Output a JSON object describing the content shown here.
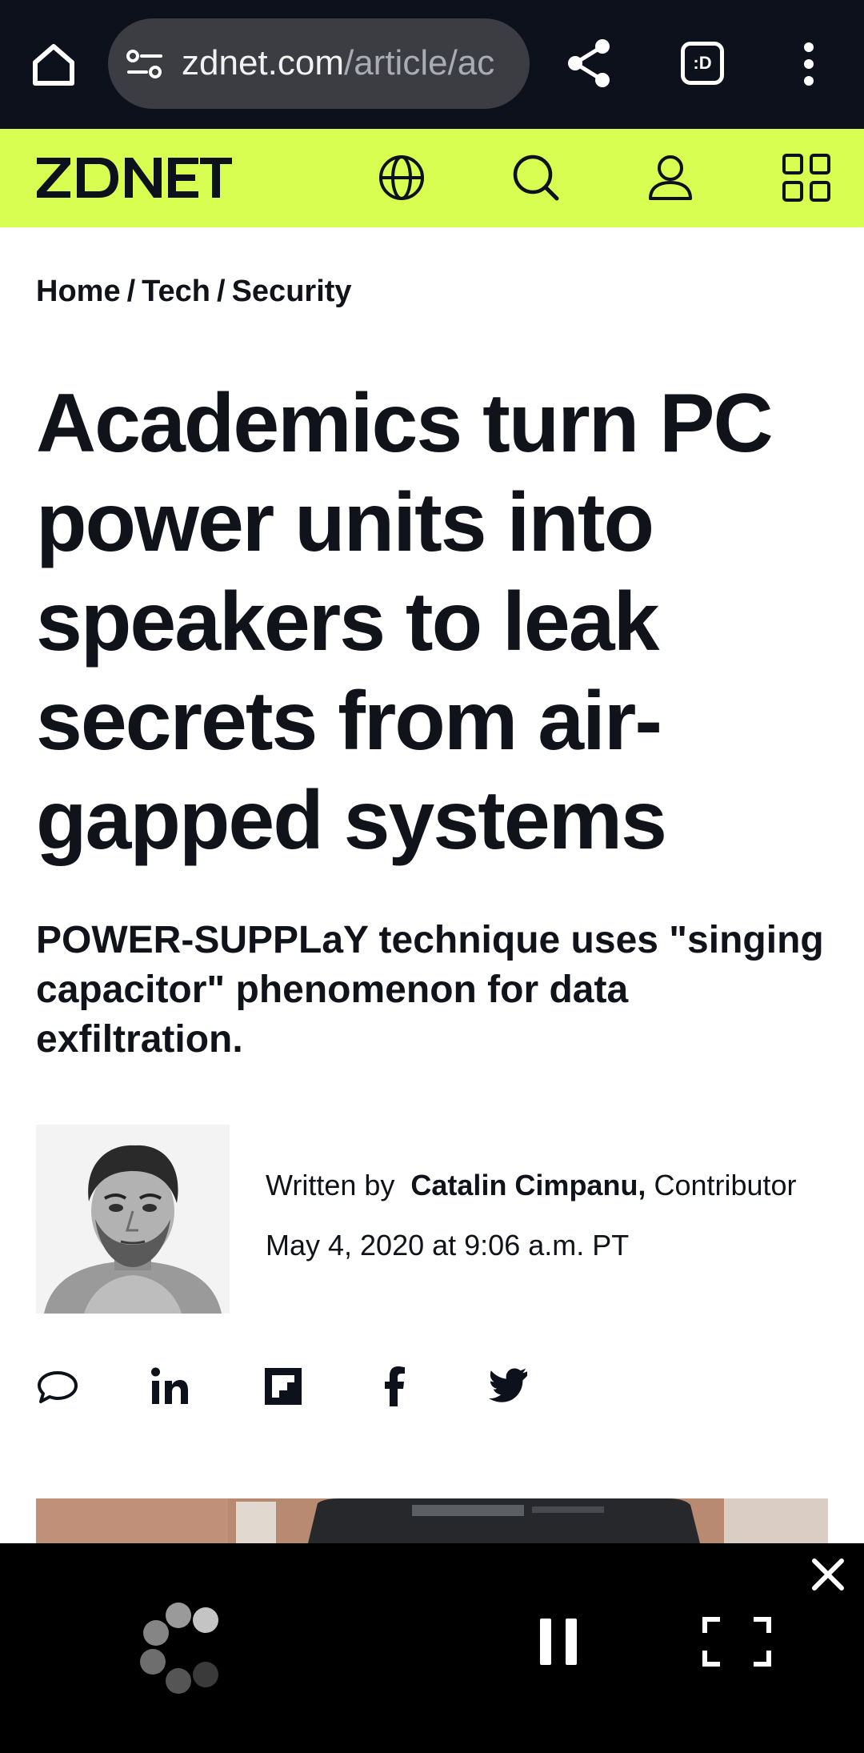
{
  "browser": {
    "url_domain": "zdnet.com",
    "url_path": "/article/ac",
    "tabs_label": ":D",
    "icons": [
      "home-icon",
      "site-info-icon",
      "share-icon",
      "tabs-icon",
      "more-vert-icon"
    ]
  },
  "site": {
    "logo_text": "ZDNET",
    "brand_color": "#d7fe51",
    "header_icons": [
      "globe-icon",
      "search-icon",
      "user-icon",
      "grid-icon"
    ]
  },
  "breadcrumb": [
    {
      "label": "Home"
    },
    {
      "label": "Tech"
    },
    {
      "label": "Security"
    }
  ],
  "breadcrumb_separator": "/",
  "article": {
    "headline": "Academics turn PC power units into speakers to leak secrets from air-gapped systems",
    "subheadline": "POWER-SUPPLaY technique uses \"singing capacitor\" phenomenon for data exfiltration.",
    "byline_prefix": "Written by",
    "author": "Catalin Cimpanu,",
    "author_role": "Contributor",
    "date": "May 4, 2020 at 9:06 a.m. PT"
  },
  "share_icons": [
    "comment-icon",
    "linkedin-icon",
    "flipboard-icon",
    "facebook-icon",
    "twitter-icon"
  ],
  "video_player": {
    "icons": [
      "close-icon",
      "spinner-icon",
      "pause-icon",
      "fullscreen-icon"
    ]
  }
}
